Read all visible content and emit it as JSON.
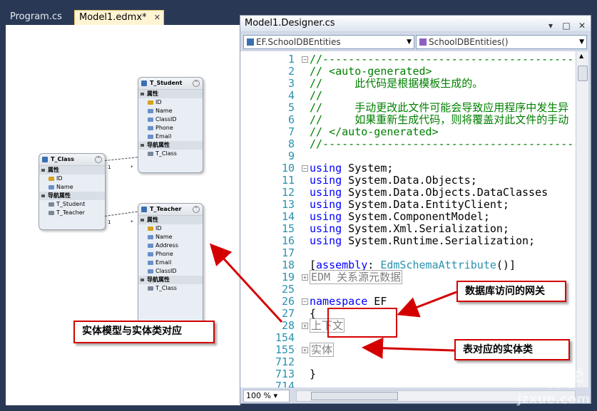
{
  "tabs": [
    {
      "label": "Program.cs"
    },
    {
      "label": "Model1.edmx*"
    }
  ],
  "entities": {
    "student": {
      "name": "T_Student",
      "props_label": "属性",
      "props": [
        "ID",
        "Name",
        "ClassID",
        "Phone",
        "Email"
      ],
      "nav_label": "导航属性",
      "nav": [
        "T_Class"
      ]
    },
    "class": {
      "name": "T_Class",
      "props_label": "属性",
      "props": [
        "ID",
        "Name"
      ],
      "nav_label": "导航属性",
      "nav": [
        "T_Student",
        "T_Teacher"
      ]
    },
    "teacher": {
      "name": "T_Teacher",
      "props_label": "属性",
      "props": [
        "ID",
        "Name",
        "Address",
        "Phone",
        "Email",
        "ClassID"
      ],
      "nav_label": "导航属性",
      "nav": [
        "T_Class"
      ]
    }
  },
  "multiplicity": {
    "one": "1",
    "many": "*"
  },
  "code_window": {
    "title": "Model1.Designer.cs",
    "buttons": [
      "▾",
      "□",
      "✕"
    ],
    "class_combo": "EF.SchoolDBEntities",
    "member_combo": "SchoolDBEntities()",
    "zoom": "100 %"
  },
  "code_lines": [
    {
      "n": "1",
      "fold": "−",
      "t": "//--------------------------------------------------",
      "c": "cm"
    },
    {
      "n": "2",
      "fold": "",
      "t": "// <auto-generated>",
      "c": "cm"
    },
    {
      "n": "3",
      "fold": "",
      "t": "//     此代码是根据模板生成的。",
      "c": "cm"
    },
    {
      "n": "4",
      "fold": "",
      "t": "//",
      "c": "cm"
    },
    {
      "n": "5",
      "fold": "",
      "t": "//     手动更改此文件可能会导致应用程序中发生异",
      "c": "cm"
    },
    {
      "n": "6",
      "fold": "",
      "t": "//     如果重新生成代码，则将覆盖对此文件的手动",
      "c": "cm"
    },
    {
      "n": "7",
      "fold": "",
      "t": "// </auto-generated>",
      "c": "cm"
    },
    {
      "n": "8",
      "fold": "",
      "t": "//--------------------------------------------------",
      "c": "cm"
    },
    {
      "n": "9",
      "fold": "",
      "t": "",
      "c": ""
    },
    {
      "n": "10",
      "fold": "−",
      "kw": "using",
      "t": " System;",
      "c": ""
    },
    {
      "n": "11",
      "fold": "",
      "kw": "using",
      "t": " System.Data.Objects;",
      "c": ""
    },
    {
      "n": "12",
      "fold": "",
      "kw": "using",
      "t": " System.Data.Objects.DataClasses",
      "c": ""
    },
    {
      "n": "13",
      "fold": "",
      "kw": "using",
      "t": " System.Data.EntityClient;",
      "c": ""
    },
    {
      "n": "14",
      "fold": "",
      "kw": "using",
      "t": " System.ComponentModel;",
      "c": ""
    },
    {
      "n": "15",
      "fold": "",
      "kw": "using",
      "t": " System.Xml.Serialization;",
      "c": ""
    },
    {
      "n": "16",
      "fold": "",
      "kw": "using",
      "t": " System.Runtime.Serialization;",
      "c": ""
    },
    {
      "n": "17",
      "fold": "",
      "t": "",
      "c": ""
    },
    {
      "n": "18",
      "fold": "",
      "attr_open": "[",
      "kw": "assembly",
      "t2": ": ",
      "ty": "EdmSchemaAttribute",
      "t": "()]",
      "c": ""
    },
    {
      "n": "19",
      "fold": "+",
      "box": "EDM 关系源元数据",
      "c": ""
    },
    {
      "n": "25",
      "fold": "",
      "t": "",
      "c": ""
    },
    {
      "n": "26",
      "fold": "−",
      "kw": "namespace",
      "t": " EF",
      "c": ""
    },
    {
      "n": "27",
      "fold": "",
      "t": "{",
      "c": ""
    },
    {
      "n": "28",
      "fold": "+",
      "box": "上下文",
      "c": ""
    },
    {
      "n": "154",
      "fold": "",
      "t": "",
      "c": ""
    },
    {
      "n": "155",
      "fold": "+",
      "box": "实体",
      "c": ""
    },
    {
      "n": "712",
      "fold": "",
      "t": "",
      "c": ""
    },
    {
      "n": "713",
      "fold": "",
      "t": "}",
      "c": ""
    },
    {
      "n": "714",
      "fold": "",
      "t": "",
      "c": ""
    }
  ],
  "callouts": {
    "gateway": "数据库访问的网关",
    "entity_class": "表对应的实体类",
    "model_map": "实体模型与实体类对应"
  },
  "watermark": {
    "big": "建站学",
    "small": "jzxue.com"
  }
}
